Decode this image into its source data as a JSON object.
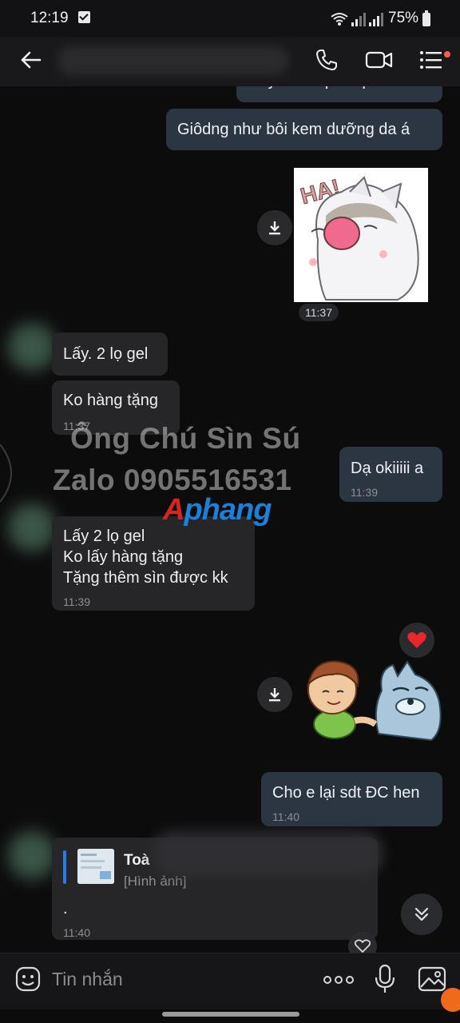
{
  "status": {
    "time": "12:19",
    "battery": "75%"
  },
  "header": {
    "title": ""
  },
  "messages": {
    "m0_partial": "Nay mo nap ra quet boi",
    "m1": "Giôdng như bôi kem dưỡng da á",
    "sticker1_time": "11:37",
    "m2": "Lấy. 2 lọ gel",
    "m3": "Ko hàng tặng",
    "m3_time": "11:37",
    "m4": "Dạ okiiiii a",
    "m4_time": "11:39",
    "m5_line1": "Lấy 2 lọ gel",
    "m5_line2": "Ko lấy hàng tặng",
    "m5_line3": "Tặng thêm sìn được kk",
    "m5_time": "11:39",
    "m6": "Cho e lại sdt ĐC hen",
    "m6_time": "11:40",
    "reply_name": "Toà",
    "reply_type": "[Hình ảnh]",
    "m7": ".",
    "m7_time": "11:40"
  },
  "watermark": {
    "line1": "Ông Chú Sìn Sú",
    "line2": "Zalo 0905516531",
    "brand_a": "A",
    "brand_rest": "phang"
  },
  "sticker1_text": "HA!",
  "input": {
    "placeholder": "Tin nhắn"
  },
  "icons": [
    "back-arrow-icon",
    "phone-icon",
    "video-icon",
    "menu-icon",
    "download-icon",
    "heart-icon",
    "emoji-icon",
    "more-icon",
    "mic-icon",
    "image-icon",
    "chevron-down-icon"
  ]
}
